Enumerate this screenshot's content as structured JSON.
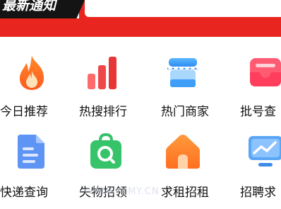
{
  "banner": {
    "title": "最新通知"
  },
  "menu": {
    "items": [
      {
        "label": "今日推荐",
        "icon": "flame-icon"
      },
      {
        "label": "热搜排行",
        "icon": "bar-chart-icon"
      },
      {
        "label": "热门商家",
        "icon": "storefront-icon"
      },
      {
        "label": "批号查",
        "icon": "inbox-tray-icon"
      },
      {
        "label": "快递查询",
        "icon": "document-icon"
      },
      {
        "label": "失物招领",
        "icon": "search-bag-icon"
      },
      {
        "label": "求租招租",
        "icon": "house-icon"
      },
      {
        "label": "招聘求",
        "icon": "monitor-chart-icon"
      }
    ]
  },
  "watermark": {
    "text": "WWW.YYMY.CN"
  },
  "colors": {
    "accent_red": "#e8251f",
    "banner_black": "#141414",
    "text": "#111111"
  }
}
